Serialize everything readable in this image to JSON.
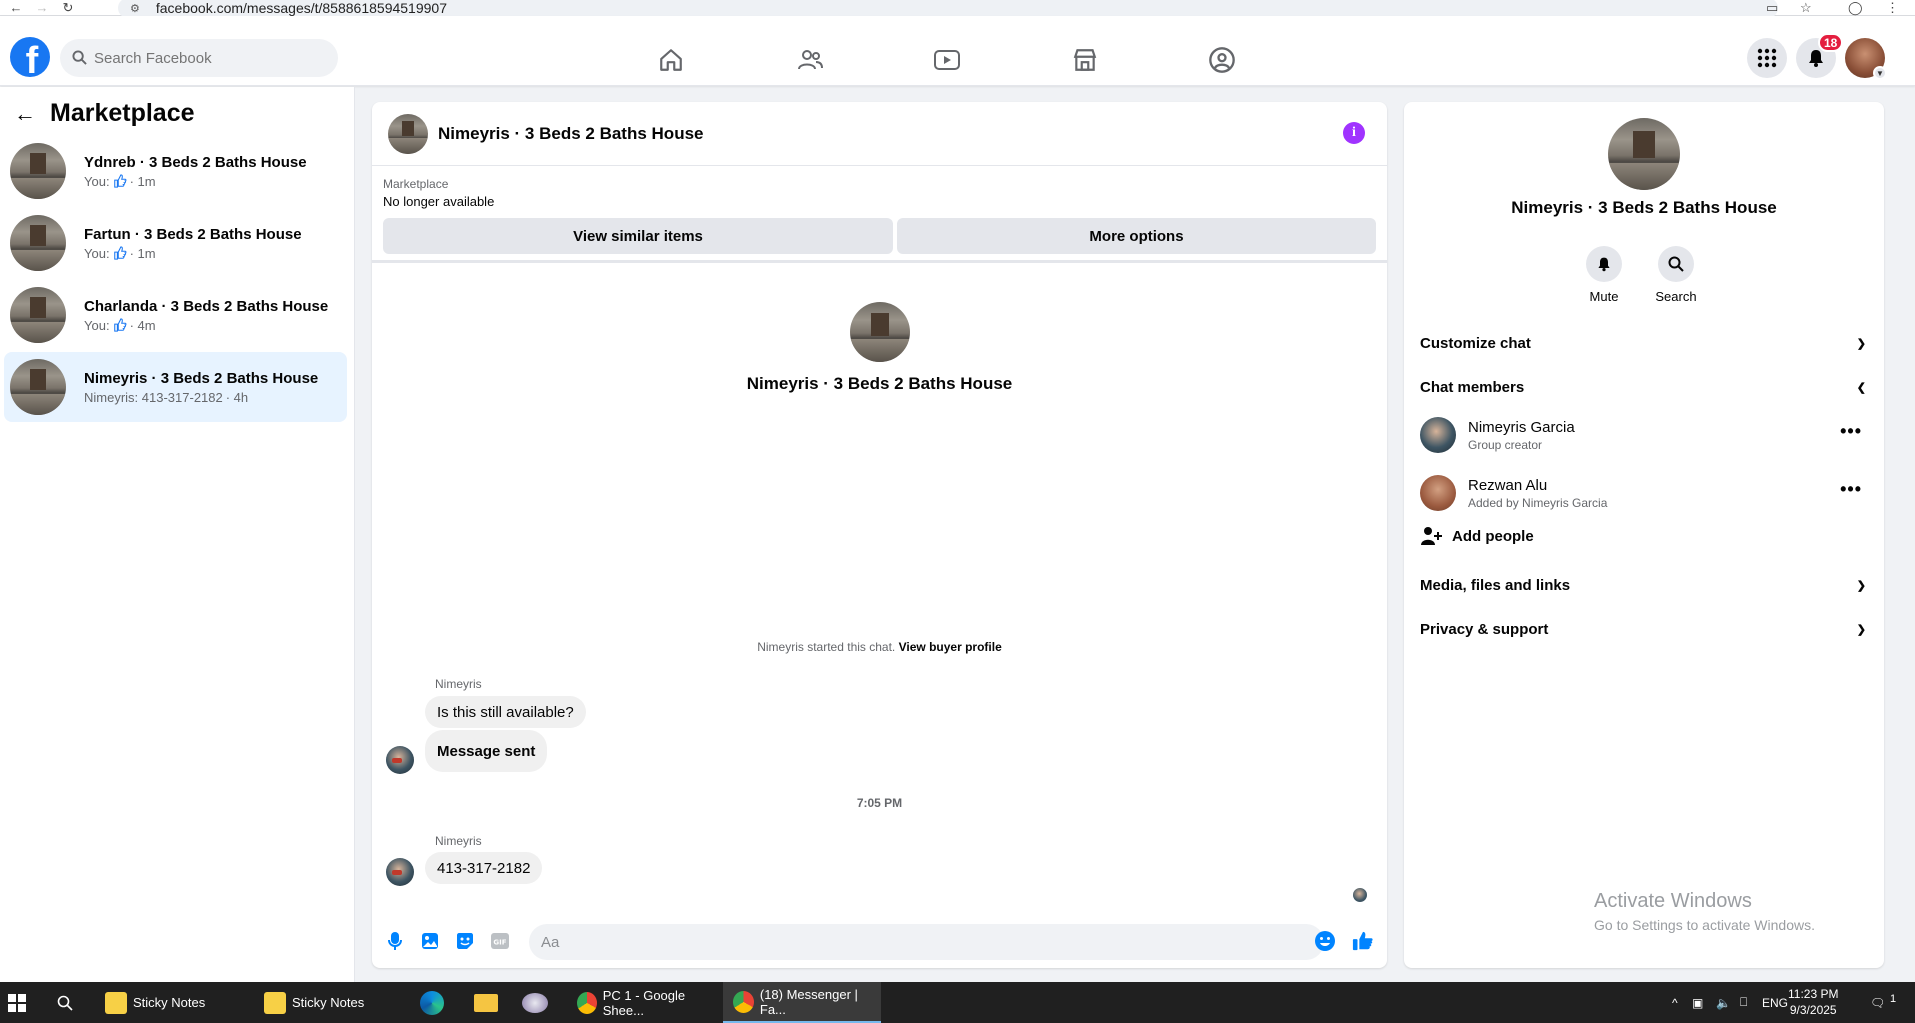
{
  "browser": {
    "url": "facebook.com/messages/t/8588618594519907"
  },
  "topnav": {
    "logo": "f",
    "search_placeholder": "Search Facebook",
    "notifications_count": "18"
  },
  "sidebar": {
    "title": "Marketplace",
    "conversations": [
      {
        "name": "Ydnreb · 3 Beds 2 Baths House",
        "sub_prefix": "You:",
        "sub_suffix": "· 1m",
        "has_like": true
      },
      {
        "name": "Fartun · 3 Beds 2 Baths House",
        "sub_prefix": "You:",
        "sub_suffix": "· 1m",
        "has_like": true
      },
      {
        "name": "Charlanda · 3 Beds 2 Baths House",
        "sub_prefix": "You:",
        "sub_suffix": "· 4m",
        "has_like": true
      },
      {
        "name": "Nimeyris · 3 Beds 2 Baths House",
        "sub_prefix": "Nimeyris: 413-317-2182",
        "sub_suffix": "· 4h",
        "has_like": false
      }
    ]
  },
  "chat": {
    "title": "Nimeyris · 3 Beds 2 Baths House",
    "banner_label": "Marketplace",
    "banner_status": "No longer available",
    "view_similar_label": "View similar items",
    "more_options_label": "More options",
    "intro_title": "Nimeyris · 3 Beds 2 Baths House",
    "started_text": "Nimeyris started this chat.",
    "buyer_profile_link": "View buyer profile",
    "sender_1": "Nimeyris",
    "msg_1": "Is this still available?",
    "msg_2": "Message sent",
    "timestamp": "7:05 PM",
    "sender_2": "Nimeyris",
    "msg_3": "413-317-2182",
    "composer_placeholder": "Aa"
  },
  "info_panel": {
    "title": "Nimeyris · 3 Beds 2 Baths House",
    "mute_label": "Mute",
    "search_label": "Search",
    "customize_chat": "Customize chat",
    "chat_members": "Chat members",
    "members": [
      {
        "name": "Nimeyris Garcia",
        "role": "Group creator"
      },
      {
        "name": "Rezwan Alu",
        "role": "Added by Nimeyris Garcia"
      }
    ],
    "add_people": "Add people",
    "media_files_links": "Media, files and links",
    "privacy_support": "Privacy & support"
  },
  "watermark": {
    "line1": "Activate Windows",
    "line2": "Go to Settings to activate Windows."
  },
  "taskbar": {
    "items": [
      {
        "label": "Sticky Notes"
      },
      {
        "label": "Sticky Notes"
      },
      {
        "label": "PC 1 - Google Shee..."
      },
      {
        "label": "(18) Messenger | Fa..."
      }
    ],
    "language": "ENG",
    "time": "11:23 PM",
    "date": "9/3/2025",
    "notif_count": "1"
  },
  "colors": {
    "fb_blue": "#1877f2",
    "active_row": "#e7f3ff",
    "info_purple": "#a033ff",
    "badge_red": "#e41e3f"
  }
}
